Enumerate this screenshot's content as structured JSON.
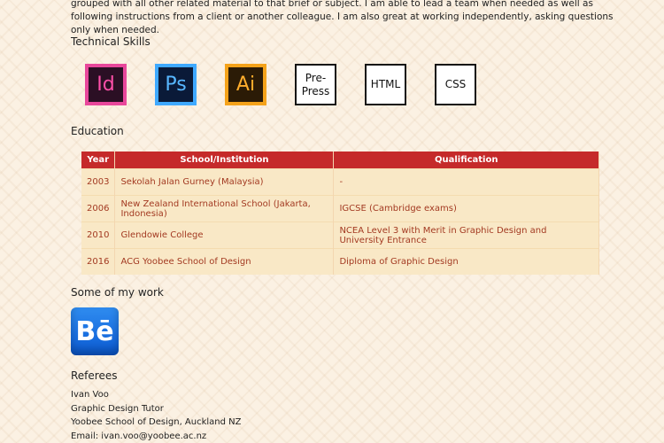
{
  "intro": {
    "line1": "grouped with all other related material to that brief or subject. I am able to lead a team when needed as well as following instructions from a client or another colleague. I am also great at working independently, asking questions only when needed."
  },
  "technical_skills": {
    "heading": "Technical Skills",
    "items": [
      {
        "label": "Id",
        "icon": "indesign-icon"
      },
      {
        "label": "Ps",
        "icon": "photoshop-icon"
      },
      {
        "label": "Ai",
        "icon": "illustrator-icon"
      },
      {
        "label": "Pre-\nPress",
        "icon": "prepress-box"
      },
      {
        "label": "HTML",
        "icon": "html-box"
      },
      {
        "label": "CSS",
        "icon": "css-box"
      }
    ]
  },
  "education": {
    "heading": "Education",
    "columns": [
      "Year",
      "School/Institution",
      "Qualification"
    ],
    "rows": [
      {
        "year": "2003",
        "school": "Sekolah Jalan Gurney (Malaysia)",
        "qualification": "-"
      },
      {
        "year": "2006",
        "school": "New Zealand International School (Jakarta, Indonesia)",
        "qualification": "IGCSE (Cambridge exams)"
      },
      {
        "year": "2010",
        "school": "Glendowie College",
        "qualification": "NCEA Level 3 with Merit in Graphic Design and University Entrance"
      },
      {
        "year": "2016",
        "school": "ACG Yoobee School of Design",
        "qualification": "Diploma of Graphic Design"
      }
    ]
  },
  "work": {
    "heading": "Some of my work",
    "behance_icon": "behance-icon",
    "behance_label": "Bē"
  },
  "referees": {
    "heading": "Referees",
    "lines": [
      "Ivan Voo",
      "Graphic Design Tutor",
      "Yoobee School of Design, Auckland NZ",
      "Email: ivan.voo@yoobee.ac.nz"
    ]
  },
  "colors": {
    "table_header": "#c52a2a",
    "table_row": "#f9e8c6",
    "table_text": "#a33a22",
    "background": "#fbf1e3"
  }
}
